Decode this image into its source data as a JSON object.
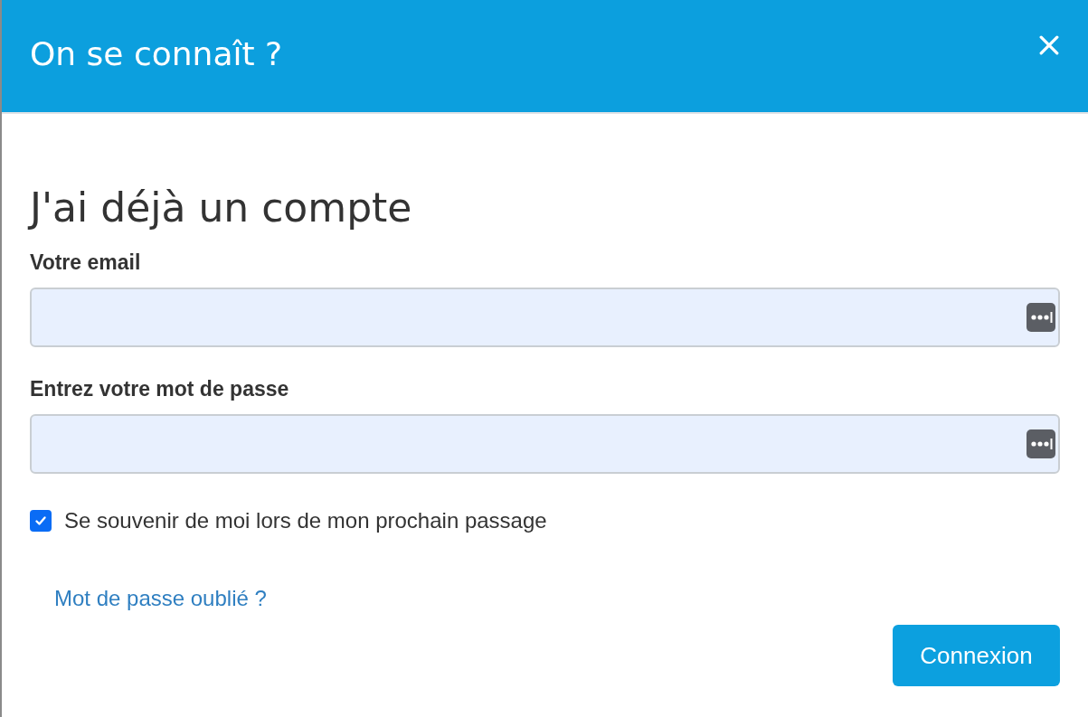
{
  "dialog": {
    "title": "On se connaît ?"
  },
  "form": {
    "heading": "J'ai déjà un compte",
    "fields": [
      {
        "label": "Votre email"
      },
      {
        "label": "Entrez votre mot de passe"
      }
    ],
    "remember": {
      "label": "Se souvenir de moi lors de mon prochain passage",
      "checked": true
    },
    "forgot_link": "Mot de passe oublié ?",
    "submit": "Connexion"
  }
}
